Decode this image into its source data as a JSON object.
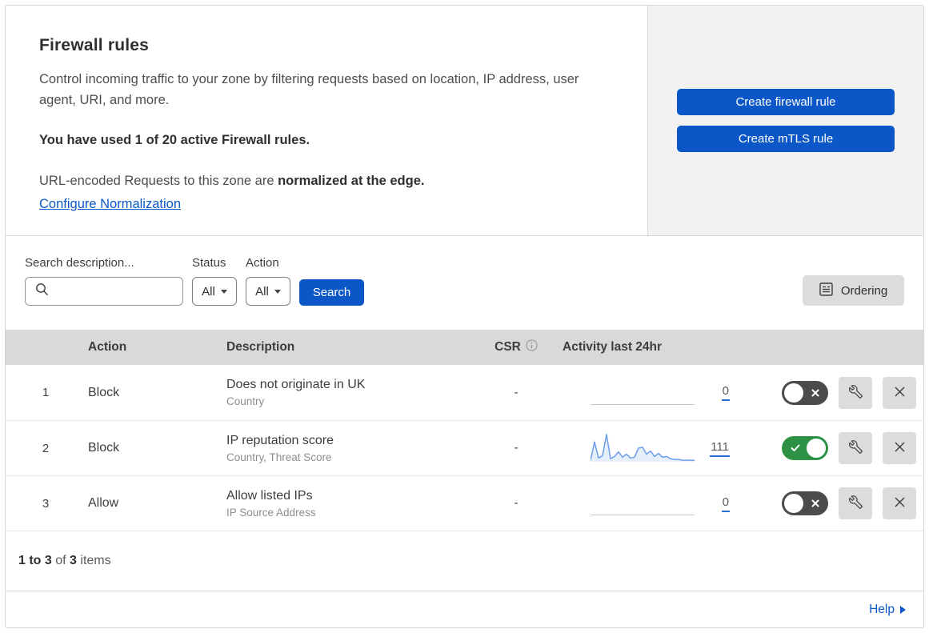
{
  "header": {
    "title": "Firewall rules",
    "description": "Control incoming traffic to your zone by filtering requests based on location, IP address, user agent, URI, and more.",
    "usage_notice": "You have used 1 of 20 active Firewall rules.",
    "normalization_prefix": "URL-encoded Requests to this zone are ",
    "normalization_bold": "normalized at the edge.",
    "normalization_link": "Configure Normalization"
  },
  "actions_panel": {
    "create_firewall_label": "Create firewall rule",
    "create_mtls_label": "Create mTLS rule"
  },
  "filters": {
    "search_label": "Search description...",
    "search_value": "",
    "status_label": "Status",
    "status_value": "All",
    "action_label": "Action",
    "action_value": "All",
    "search_button_label": "Search",
    "ordering_button_label": "Ordering"
  },
  "table": {
    "headers": {
      "action": "Action",
      "description": "Description",
      "csr": "CSR",
      "activity": "Activity last 24hr"
    },
    "rows": [
      {
        "position": "1",
        "action": "Block",
        "description": "Does not originate in UK",
        "match_fields": "Country",
        "csr": "-",
        "activity_count": "0",
        "enabled": false
      },
      {
        "position": "2",
        "action": "Block",
        "description": "IP reputation score",
        "match_fields": "Country, Threat Score",
        "csr": "-",
        "activity_count": "111",
        "enabled": true,
        "sparkline": [
          2,
          26,
          5,
          8,
          36,
          4,
          7,
          13,
          6,
          10,
          5,
          6,
          18,
          19,
          10,
          14,
          7,
          11,
          6,
          7,
          4,
          3,
          3,
          2,
          2,
          2,
          2
        ]
      },
      {
        "position": "3",
        "action": "Allow",
        "description": "Allow listed IPs",
        "match_fields": "IP Source Address",
        "csr": "-",
        "activity_count": "0",
        "enabled": false
      }
    ]
  },
  "footer": {
    "range": "1 to 3",
    "of_text": "of",
    "total": "3",
    "items_text": "items"
  },
  "help": {
    "label": "Help"
  },
  "colors": {
    "brand_blue": "#0b57c7",
    "panel_gray": "#f2f2f2",
    "table_header_gray": "#d9d9d9",
    "toggle_on_green": "#2d9144",
    "toggle_off_gray": "#4a4b4d",
    "sparkline_blue": "#6d9eea",
    "link_underline_blue": "#2b6fce"
  },
  "icons": {
    "search": "magnifier-icon",
    "status_caret": "triangle-down",
    "action_caret": "triangle-down",
    "ordering": "list-box-icon",
    "csr_info": "info-circle-icon",
    "edit": "wrench-icon",
    "delete": "x-icon",
    "toggle_off_mark": "x-mark",
    "toggle_on_mark": "check-mark",
    "help_arrow": "triangle-right"
  }
}
